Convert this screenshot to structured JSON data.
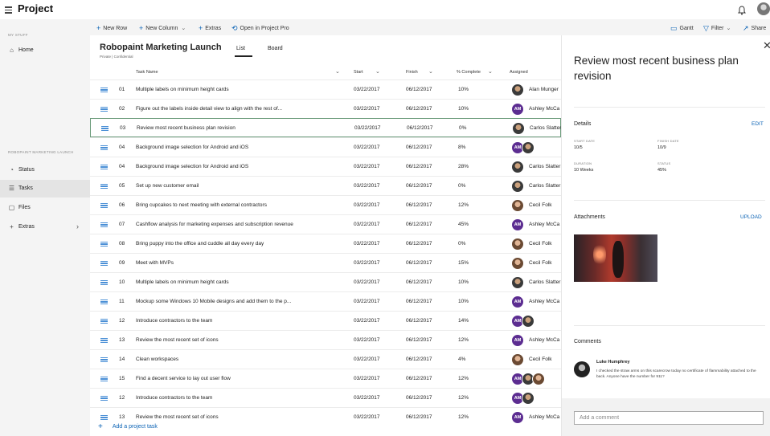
{
  "app": {
    "title": "Project"
  },
  "toolbar": {
    "new_row": "New Row",
    "new_column": "New Column",
    "extras": "Extras",
    "open_in_project_pro": "Open in Project Pro",
    "gantt": "Gantt",
    "filter": "Filter",
    "share": "Share"
  },
  "sidebar": {
    "my_stuff": "MY STUFF",
    "home": "Home",
    "section": "ROBOPAINT MARKETING LAUNCH",
    "items": [
      {
        "label": "Status",
        "icon": "status-icon"
      },
      {
        "label": "Tasks",
        "icon": "tasks-icon"
      },
      {
        "label": "Files",
        "icon": "files-icon"
      },
      {
        "label": "Extras",
        "icon": "plus-icon"
      }
    ]
  },
  "project": {
    "title": "Robopaint Marketing Launch",
    "subtitle": "Private | Confidential",
    "tabs": [
      "List",
      "Board"
    ],
    "active_tab": "List"
  },
  "columns": {
    "task_name": "Task Name",
    "start": "Start",
    "finish": "Finish",
    "pct_complete": "% Complete",
    "assigned": "Assigned"
  },
  "tasks": [
    {
      "num": "01",
      "name": "Multiple labels on minimum height cards",
      "start": "03/22/2017",
      "finish": "06/12/2017",
      "pct": "10%",
      "assigned": "Alan Munger",
      "avatars": [
        "ph"
      ]
    },
    {
      "num": "02",
      "name": "Figure out the labels inside detail view to align with the rest of...",
      "start": "03/22/2017",
      "finish": "06/12/2017",
      "pct": "10%",
      "assigned": "Ashley McCa",
      "avatars": [
        "AM"
      ]
    },
    {
      "num": "03",
      "name": "Review most recent business plan revision",
      "start": "03/22/2017",
      "finish": "06/12/2017",
      "pct": "0%",
      "assigned": "Carlos Slatter",
      "avatars": [
        "ph"
      ],
      "selected": true
    },
    {
      "num": "04",
      "name": "Background image selection for Android and iOS",
      "start": "03/22/2017",
      "finish": "06/12/2017",
      "pct": "8%",
      "assigned": "",
      "avatars": [
        "AM",
        "ph"
      ]
    },
    {
      "num": "04",
      "name": "Background image selection for Android and iOS",
      "start": "03/22/2017",
      "finish": "06/12/2017",
      "pct": "28%",
      "assigned": "Carlos Slatter",
      "avatars": [
        "ph"
      ]
    },
    {
      "num": "05",
      "name": "Set up new customer email",
      "start": "03/22/2017",
      "finish": "06/12/2017",
      "pct": "0%",
      "assigned": "Carlos Slatter",
      "avatars": [
        "ph"
      ]
    },
    {
      "num": "06",
      "name": "Bring cupcakes to next meeting with external contractors",
      "start": "03/22/2017",
      "finish": "06/12/2017",
      "pct": "12%",
      "assigned": "Cecil Folk",
      "avatars": [
        "ph2"
      ]
    },
    {
      "num": "07",
      "name": "Cashflow analysis for marketing expenses and subscription revenue",
      "start": "03/22/2017",
      "finish": "06/12/2017",
      "pct": "45%",
      "assigned": "Ashley McCa",
      "avatars": [
        "AM"
      ]
    },
    {
      "num": "08",
      "name": "Bring puppy into the office and cuddle all day every day",
      "start": "03/22/2017",
      "finish": "06/12/2017",
      "pct": "0%",
      "assigned": "Cecil Folk",
      "avatars": [
        "ph2"
      ]
    },
    {
      "num": "09",
      "name": "Meet with MVPs",
      "start": "03/22/2017",
      "finish": "06/12/2017",
      "pct": "15%",
      "assigned": "Cecil Folk",
      "avatars": [
        "ph2"
      ]
    },
    {
      "num": "10",
      "name": "Multiple labels on minimum height cards",
      "start": "03/22/2017",
      "finish": "06/12/2017",
      "pct": "10%",
      "assigned": "Carlos Slatter",
      "avatars": [
        "ph"
      ]
    },
    {
      "num": "11",
      "name": "Mockup some Windows 10 Mobile designs and add them to the p...",
      "start": "03/22/2017",
      "finish": "06/12/2017",
      "pct": "10%",
      "assigned": "Ashley McCa",
      "avatars": [
        "AM"
      ]
    },
    {
      "num": "12",
      "name": "Introduce contractors to the team",
      "start": "03/22/2017",
      "finish": "06/12/2017",
      "pct": "14%",
      "assigned": "",
      "avatars": [
        "AM",
        "ph"
      ]
    },
    {
      "num": "13",
      "name": "Review the most recent set of icons",
      "start": "03/22/2017",
      "finish": "06/12/2017",
      "pct": "12%",
      "assigned": "Ashley McCa",
      "avatars": [
        "AM"
      ]
    },
    {
      "num": "14",
      "name": "Clean workspaces",
      "start": "03/22/2017",
      "finish": "06/12/2017",
      "pct": "4%",
      "assigned": "Cecil Folk",
      "avatars": [
        "ph2"
      ]
    },
    {
      "num": "15",
      "name": "Find a decent service to lay out user flow",
      "start": "03/22/2017",
      "finish": "06/12/2017",
      "pct": "12%",
      "assigned": "",
      "avatars": [
        "AM",
        "ph",
        "ph2"
      ]
    },
    {
      "num": "12",
      "name": "Introduce contractors to the team",
      "start": "03/22/2017",
      "finish": "06/12/2017",
      "pct": "12%",
      "assigned": "",
      "avatars": [
        "AM",
        "ph"
      ]
    },
    {
      "num": "13",
      "name": "Review the most recent set of icons",
      "start": "03/22/2017",
      "finish": "06/12/2017",
      "pct": "12%",
      "assigned": "Ashley McCa",
      "avatars": [
        "AM"
      ]
    }
  ],
  "add_task": "Add a project task",
  "detail": {
    "title": "Review most recent business plan revision",
    "details_label": "Details",
    "edit": "EDIT",
    "start_date_label": "START DATE",
    "start_date": "10/5",
    "finish_date_label": "FINISH DATE",
    "finish_date": "10/9",
    "duration_label": "DURATION",
    "duration": "10 Weeks",
    "status_label": "STATUS",
    "status": "45%",
    "attachments_label": "Attachments",
    "upload": "UPLOAD",
    "comments_label": "Comments",
    "comment_author": "Luke Humphrey",
    "comment_text": "I checked the straw arms on this scarecrow today no certificate of flammability attached to the back. Anyone have the number for 911?",
    "comment_placeholder": "Add a comment"
  }
}
